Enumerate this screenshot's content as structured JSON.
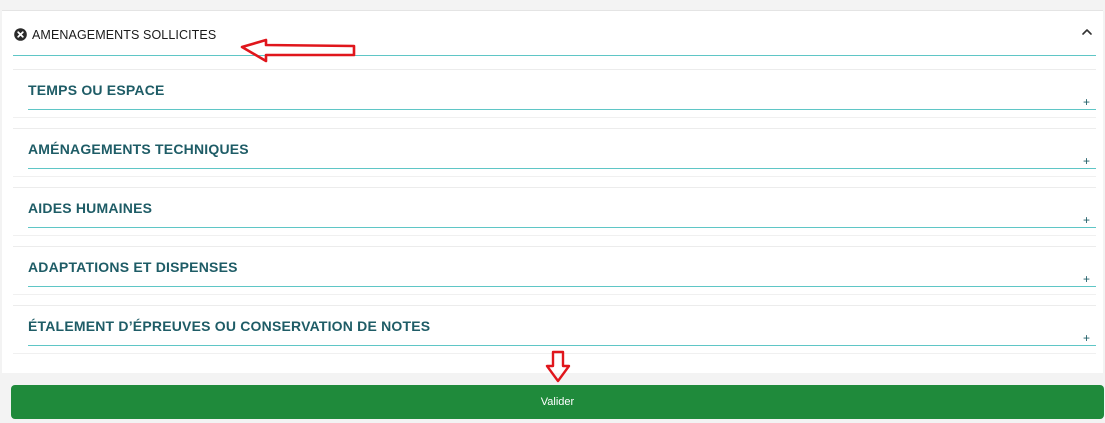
{
  "panel": {
    "title": "AMENAGEMENTS SOLLICITES",
    "header_icon": "close-circle-icon",
    "collapse_icon": "chevron-up-icon"
  },
  "sections": [
    {
      "label": "TEMPS OU ESPACE",
      "toggle": "+"
    },
    {
      "label": "AMÉNAGEMENTS TECHNIQUES",
      "toggle": "+"
    },
    {
      "label": "AIDES HUMAINES",
      "toggle": "+"
    },
    {
      "label": "ADAPTATIONS ET DISPENSES",
      "toggle": "+"
    },
    {
      "label": "ÉTALEMENT D’ÉPREUVES OU CONSERVATION DE NOTES",
      "toggle": "+"
    }
  ],
  "actions": {
    "submit_label": "Valider"
  },
  "colors": {
    "section_text": "#1e5c66",
    "divider": "#5fc6c6",
    "submit_bg": "#1f8a3b",
    "annotation": "#e0161c"
  },
  "annotations": {
    "arrow_left_icon": "red-arrow-left-icon",
    "arrow_down_icon": "red-arrow-down-icon"
  }
}
